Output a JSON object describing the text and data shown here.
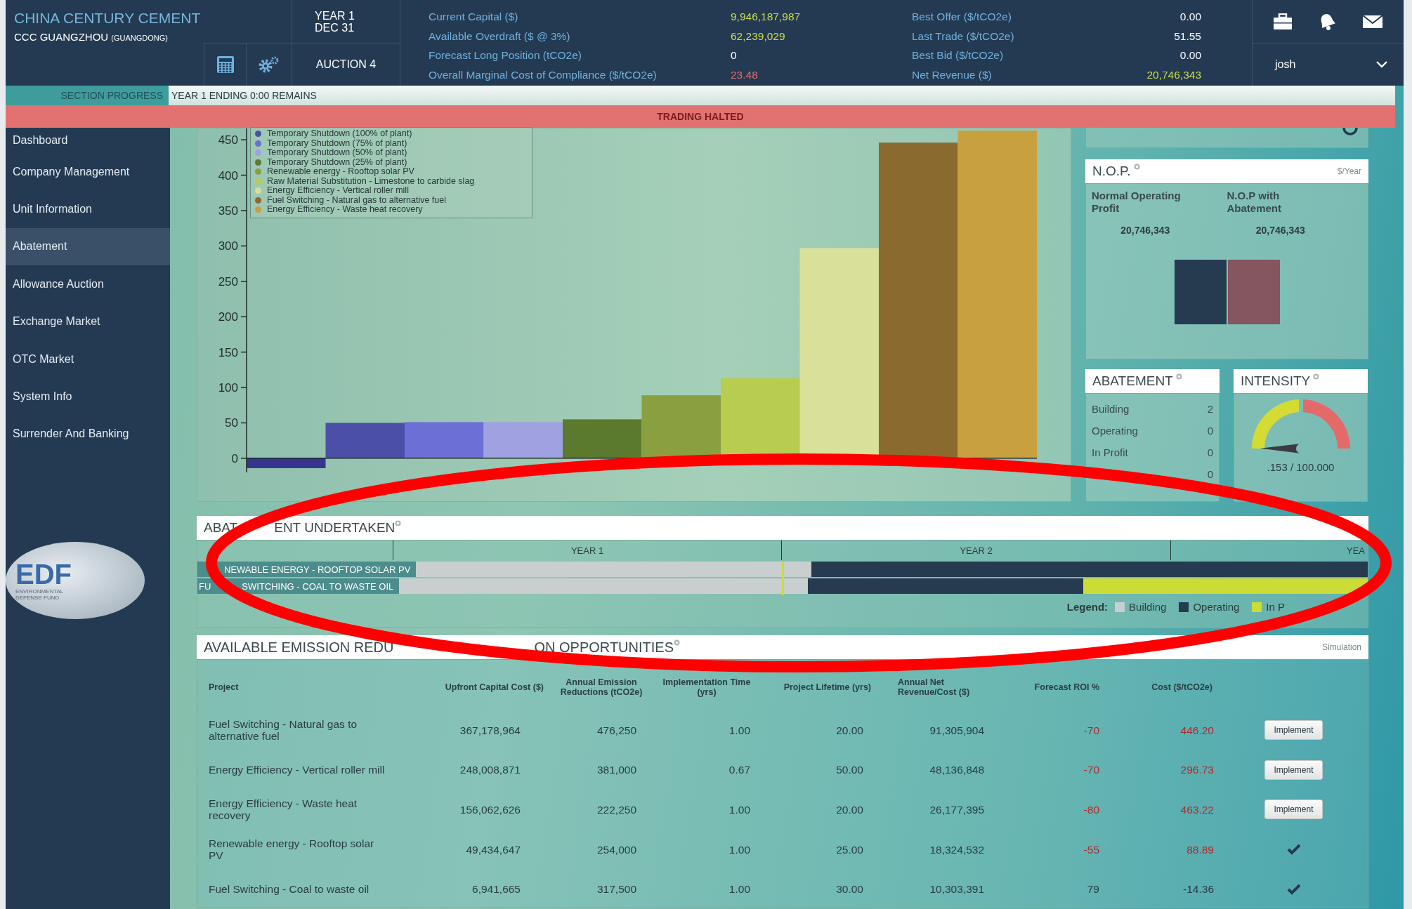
{
  "header": {
    "company": "CHINA CENTURY CEMENT",
    "site": "CCC GUANGZHOU",
    "region": "(GUANGDONG)",
    "year": "YEAR 1",
    "date": "DEC 31",
    "auction": "AUCTION 4",
    "stats_left": [
      {
        "label": "Current Capital ($)",
        "value": "9,946,187,987",
        "kind": "positive"
      },
      {
        "label": "Available Overdraft ($ @ 3%)",
        "value": "62,239,029",
        "kind": "positive"
      },
      {
        "label": "Forecast Long Position (tCO2e)",
        "value": "0",
        "kind": "neutral"
      },
      {
        "label": "Overall Marginal Cost of Compliance ($/tCO2e)",
        "value": "23.48",
        "kind": "negative"
      }
    ],
    "stats_right": [
      {
        "label": "Best Offer ($/tCO2e)",
        "value": "0.00",
        "kind": "neutral"
      },
      {
        "label": "Last Trade ($/tCO2e)",
        "value": "51.55",
        "kind": "neutral"
      },
      {
        "label": "Best Bid ($/tCO2e)",
        "value": "0.00",
        "kind": "neutral"
      },
      {
        "label": "Net Revenue ($)",
        "value": "20,746,343",
        "kind": "positive"
      }
    ],
    "user": "josh"
  },
  "progress": {
    "label": "SECTION PROGRESS",
    "text": "YEAR 1 ENDING 0:00 REMAINS"
  },
  "banner": "TRADING HALTED",
  "sidebar": {
    "items": [
      {
        "label": "Dashboard",
        "selected": false
      },
      {
        "label": "Company Management",
        "selected": false
      },
      {
        "label": "Unit Information",
        "selected": false
      },
      {
        "label": "Abatement",
        "selected": true
      },
      {
        "label": "Allowance Auction",
        "selected": false
      },
      {
        "label": "Exchange Market",
        "selected": false
      },
      {
        "label": "OTC Market",
        "selected": false
      },
      {
        "label": "System Info",
        "selected": false
      },
      {
        "label": "Surrender And Banking",
        "selected": false
      }
    ],
    "logo": {
      "text": "EDF",
      "caption": "ENVIRONMENTAL DEFENSE FUND"
    }
  },
  "macc": {
    "chart_data": {
      "type": "bar",
      "stacked": true,
      "categories": [
        null,
        null,
        null,
        null,
        null,
        null,
        null,
        null,
        null,
        null
      ],
      "series": [
        {
          "color": "#35358c",
          "values": [
            -14,
            null,
            null,
            null,
            null,
            null,
            null,
            null,
            null,
            null
          ]
        },
        {
          "name": "Temporary Shutdown (100% of plant)",
          "color": "#4c4fa8",
          "values": [
            null,
            50,
            null,
            null,
            null,
            null,
            null,
            null,
            null,
            null
          ]
        },
        {
          "name": "Temporary Shutdown (75% of plant)",
          "color": "#6b6fd6",
          "values": [
            null,
            null,
            51,
            null,
            null,
            null,
            null,
            null,
            null,
            null
          ]
        },
        {
          "name": "Temporary Shutdown (50% of plant)",
          "color": "#9fa1e0",
          "values": [
            null,
            null,
            null,
            51,
            null,
            null,
            null,
            null,
            null,
            null
          ]
        },
        {
          "name": "Temporary Shutdown (25% of plant)",
          "color": "#5b7a2e",
          "values": [
            null,
            null,
            null,
            null,
            55,
            null,
            null,
            null,
            null,
            null
          ]
        },
        {
          "name": "Renewable energy - Rooftop solar PV",
          "color": "#8aa040",
          "values": [
            null,
            null,
            null,
            null,
            null,
            89,
            null,
            null,
            null,
            null
          ]
        },
        {
          "name": "Raw Material Substitution - Limestone to carbide slag",
          "color": "#b8cc50",
          "values": [
            null,
            null,
            null,
            null,
            null,
            null,
            113,
            null,
            null,
            null
          ]
        },
        {
          "name": "Energy Efficiency - Vertical roller mill",
          "color": "#d8e09a",
          "values": [
            null,
            null,
            null,
            null,
            null,
            null,
            null,
            297,
            null,
            null
          ]
        },
        {
          "name": "Fuel Switching - Natural gas to alternative fuel",
          "color": "#8b6a30",
          "values": [
            null,
            null,
            null,
            null,
            null,
            null,
            null,
            null,
            446,
            null
          ]
        },
        {
          "name": "Energy Efficiency - Waste heat recovery",
          "color": "#c9a040",
          "values": [
            null,
            null,
            null,
            null,
            null,
            null,
            null,
            null,
            null,
            463
          ]
        }
      ],
      "ylim": [
        -20,
        470
      ],
      "yticks": [
        0,
        50,
        100,
        150,
        200,
        250,
        300,
        350,
        400,
        450
      ]
    }
  },
  "nop": {
    "title": "N.O.P.",
    "unit": "$/Year",
    "columns": [
      {
        "label": "Normal Operating Profit",
        "value": "20,746,343",
        "color": "#263a50"
      },
      {
        "label": "N.O.P with Abatement",
        "value": "20,746,343",
        "color": "#855560"
      }
    ]
  },
  "abatement": {
    "title": "ABATEMENT",
    "rows": [
      {
        "label": "Building",
        "value": "2"
      },
      {
        "label": "Operating",
        "value": "0"
      },
      {
        "label": "In Profit",
        "value": "0"
      },
      {
        "value": "0"
      }
    ]
  },
  "intensity": {
    "title": "INTENSITY",
    "reading": ".153 / 100.000"
  },
  "undertaken": {
    "title_start": "ABAT",
    "title_end": "ENT UNDERTAKEN",
    "years": [
      "YEAR 1",
      "YEAR 2",
      "YEA"
    ],
    "rows": [
      {
        "label": "NEWABLE ENERGY - ROOFTOP SOLAR PV",
        "segments": [
          {
            "kind": "building"
          },
          {
            "kind": "operating"
          }
        ]
      },
      {
        "label_start": "FU",
        "label": "SWITCHING - COAL TO WASTE OIL",
        "segments": [
          {
            "kind": "building"
          },
          {
            "kind": "operating"
          },
          {
            "kind": "profit"
          }
        ]
      }
    ],
    "legend_title": "Legend:",
    "legend": [
      {
        "kind": "building",
        "label": "Building"
      },
      {
        "kind": "operating",
        "label": "Operating"
      },
      {
        "kind": "profit",
        "label": "In P"
      }
    ]
  },
  "opportunities": {
    "title_start": "AVAILABLE EMISSION REDU",
    "title_end": "ON OPPORTUNITIES",
    "mode": "Simulation",
    "columns": [
      "Project",
      "Upfront Capital Cost ($)",
      "Annual Emission Reductions (tCO2e)",
      "Implementation Time (yrs)",
      "Project Lifetime (yrs)",
      "Annual Net Revenue/Cost ($)",
      "Forecast ROI %",
      "Cost ($/tCO2e)"
    ],
    "rows": [
      {
        "cells": [
          "Fuel Switching - Natural gas to alternative fuel",
          "367,178,964",
          "476,250",
          "1.00",
          "20.00",
          "91,305,904",
          "-70",
          "446.20"
        ],
        "unprofitable": true,
        "implemented": false,
        "action": "Implement"
      },
      {
        "cells": [
          "Energy Efficiency - Vertical roller mill",
          "248,008,871",
          "381,000",
          "0.67",
          "50.00",
          "48,136,848",
          "-70",
          "296.73"
        ],
        "unprofitable": true,
        "implemented": false,
        "action": "Implement"
      },
      {
        "cells": [
          "Energy Efficiency - Waste heat recovery",
          "156,062,626",
          "222,250",
          "1.00",
          "20.00",
          "26,177,395",
          "-80",
          "463.22"
        ],
        "unprofitable": true,
        "implemented": false,
        "action": "Implement"
      },
      {
        "cells": [
          "Renewable energy - Rooftop solar PV",
          "49,434,647",
          "254,000",
          "1.00",
          "25.00",
          "18,324,532",
          "-55",
          "88.89"
        ],
        "unprofitable": true,
        "implemented": true
      },
      {
        "cells": [
          "Fuel Switching - Coal to waste oil",
          "6,941,665",
          "317,500",
          "1.00",
          "30.00",
          "10,303,391",
          "79",
          "-14.36"
        ],
        "unprofitable": false,
        "implemented": true
      }
    ]
  }
}
